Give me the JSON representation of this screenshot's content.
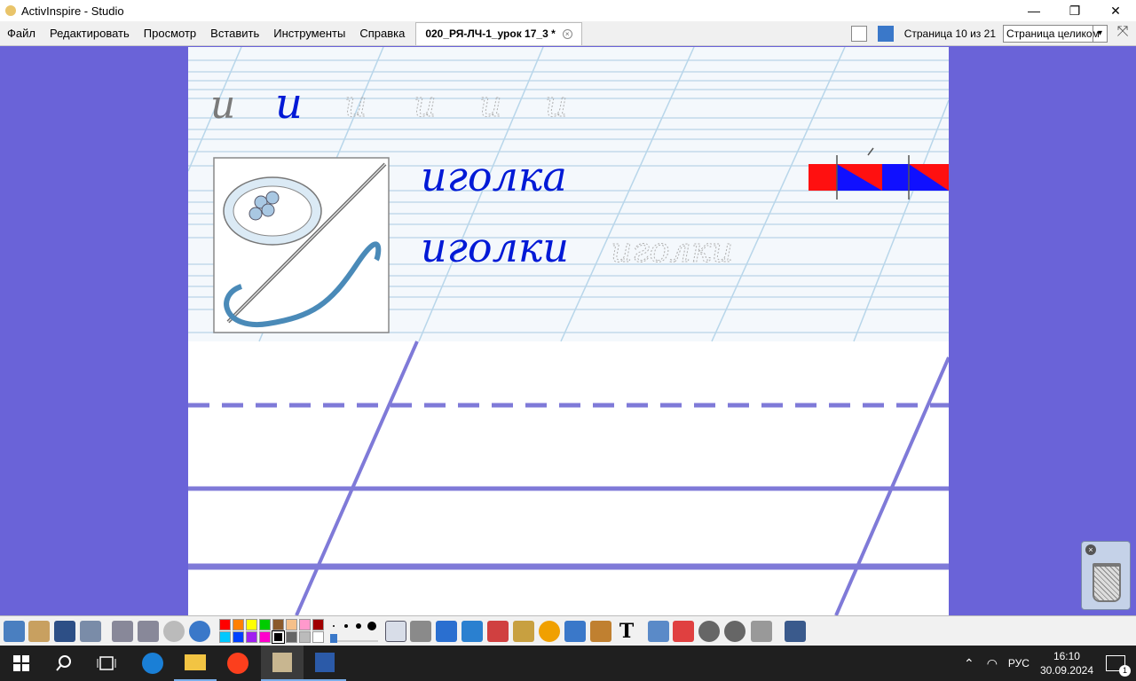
{
  "window": {
    "title": "ActivInspire - Studio",
    "minimize": "—",
    "maximize": "❐",
    "close": "✕"
  },
  "menu": {
    "items": [
      "Файл",
      "Редактировать",
      "Просмотр",
      "Вставить",
      "Инструменты",
      "Справка"
    ],
    "doc_tab": "020_РЯ-ЛЧ-1_урок 17_3 *",
    "tab_close": "×",
    "page_counter": "Страница 10 из 21",
    "zoom_value": "Страница целиком",
    "zoom_arrow": "▾",
    "fullscreen": "⤧"
  },
  "worksheet": {
    "letters_row": [
      "и",
      "и",
      "и",
      "и",
      "и",
      "и"
    ],
    "word_1": "иголка",
    "word_2": "иголки",
    "word_2_trace": "иголки"
  },
  "trash": {
    "close": "×"
  },
  "toolbar": {
    "palette_top": [
      "#ff0000",
      "#ff8000",
      "#ffff00",
      "#00cc00",
      "#8b5a2b",
      "#f5c08a",
      "#ff99cc",
      "#a00000"
    ],
    "palette_bottom": [
      "#00c8ff",
      "#0040ff",
      "#a020f0",
      "#ff00cc",
      "#000000",
      "#666666",
      "#bbbbbb",
      "#ffffff"
    ],
    "text_tool": "T"
  },
  "taskbar": {
    "lang": "РУС",
    "time": "16:10",
    "date": "30.09.2024",
    "notifications": "1"
  },
  "colors": {
    "background": "#6a63d8",
    "ink_blue": "#0019d6",
    "line_blue": "#7f7ad8"
  }
}
